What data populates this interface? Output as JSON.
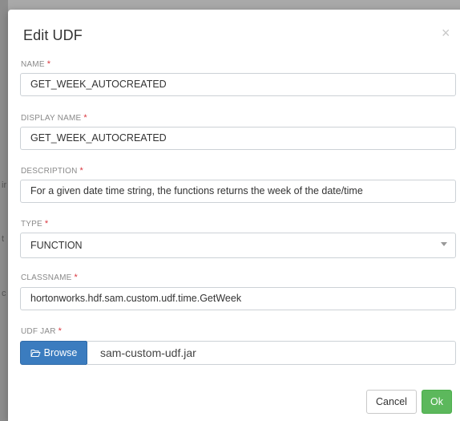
{
  "dialog": {
    "title": "Edit UDF",
    "close_glyph": "×"
  },
  "fields": {
    "name": {
      "label": "NAME",
      "required_mark": "*",
      "value": "GET_WEEK_AUTOCREATED"
    },
    "display_name": {
      "label": "DISPLAY NAME",
      "required_mark": "*",
      "value": "GET_WEEK_AUTOCREATED"
    },
    "description": {
      "label": "DESCRIPTION",
      "required_mark": "*",
      "value": "For a given date time string, the functions returns the week of the date/time"
    },
    "type": {
      "label": "TYPE",
      "required_mark": "*",
      "value": "FUNCTION"
    },
    "classname": {
      "label": "CLASSNAME",
      "required_mark": "*",
      "value": "hortonworks.hdf.sam.custom.udf.time.GetWeek"
    },
    "udf_jar": {
      "label": "UDF JAR",
      "required_mark": "*",
      "browse_label": "Browse",
      "file_name": "sam-custom-udf.jar"
    }
  },
  "footer": {
    "cancel_label": "Cancel",
    "ok_label": "Ok"
  },
  "colors": {
    "primary": "#3b7cbf",
    "success": "#5cb85c",
    "required": "#d9363e"
  },
  "icons": {
    "close": "close-icon",
    "browse": "folder-open-icon",
    "select": "caret-down-icon"
  },
  "backdrop": {
    "marks": [
      "ir",
      "t",
      "c"
    ]
  }
}
